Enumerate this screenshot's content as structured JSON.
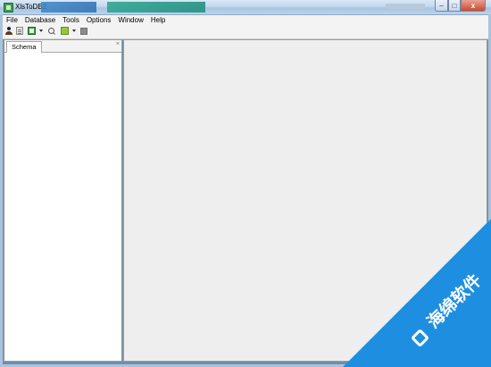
{
  "window": {
    "title": "XlsToDB2",
    "controls": {
      "minimize": "–",
      "maximize": "□",
      "close": "x"
    }
  },
  "menu": {
    "items": [
      {
        "label": "File"
      },
      {
        "label": "Database"
      },
      {
        "label": "Tools"
      },
      {
        "label": "Options"
      },
      {
        "label": "Window"
      },
      {
        "label": "Help"
      }
    ]
  },
  "toolbar": {
    "icons": [
      "user-icon",
      "document-icon",
      "spreadsheet-icon",
      "dropdown-arrow-icon",
      "magnifier-icon",
      "database-icon",
      "dropdown-arrow-icon",
      "stop-icon"
    ]
  },
  "left_panel": {
    "tab_label": "Schema",
    "close_glyph": "×"
  },
  "watermark": {
    "text": "海绵软件",
    "color": "#1e8fe0"
  },
  "colors": {
    "main_background": "#eeeeee",
    "panel_background": "#ffffff",
    "titlebar": "#c3d8ec"
  }
}
